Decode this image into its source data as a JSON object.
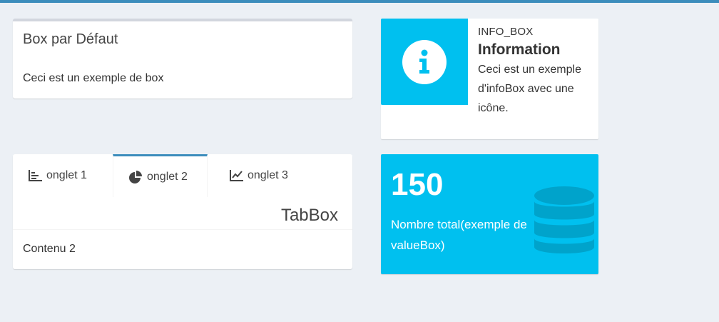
{
  "default_box": {
    "title": "Box par Défaut",
    "body": "Ceci est un exemple de box"
  },
  "info_box": {
    "text": "INFO_BOX",
    "value": "Information",
    "description": "Ceci est un exemple d'infoBox avec une icône.",
    "icon": "info-circle-icon",
    "color": "#00c0ef"
  },
  "tab_box": {
    "title": "TabBox",
    "tabs": [
      {
        "label": "onglet 1",
        "icon": "bar-chart-icon"
      },
      {
        "label": "onglet 2",
        "icon": "pie-chart-icon"
      },
      {
        "label": "onglet 3",
        "icon": "line-chart-icon"
      }
    ],
    "selected_tab": "onglet 2",
    "content": "Contenu 2",
    "accent_color": "#3c8dbc"
  },
  "value_box": {
    "value": "150",
    "subtitle": "Nombre total(exemple de valueBox)",
    "icon": "database-icon",
    "color": "#00c0ef"
  },
  "theme": {
    "header_color": "#3c8dbc",
    "background": "#ecf0f5"
  }
}
